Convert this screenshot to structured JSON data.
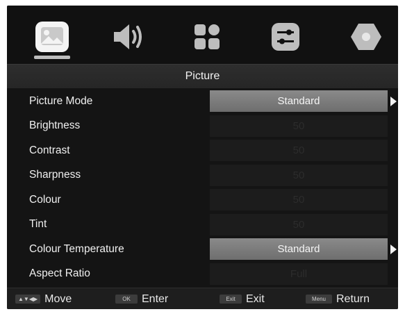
{
  "menu_tabs": [
    {
      "name": "picture-icon",
      "selected": true
    },
    {
      "name": "sound-icon",
      "selected": false
    },
    {
      "name": "apps-icon",
      "selected": false
    },
    {
      "name": "settings-sliders-icon",
      "selected": false
    },
    {
      "name": "lock-icon",
      "selected": false
    }
  ],
  "title": "Picture",
  "rows": [
    {
      "label": "Picture Mode",
      "value": "Standard",
      "selected": true
    },
    {
      "label": "Brightness",
      "value": "50",
      "selected": false
    },
    {
      "label": "Contrast",
      "value": "50",
      "selected": false
    },
    {
      "label": "Sharpness",
      "value": "50",
      "selected": false
    },
    {
      "label": "Colour",
      "value": "50",
      "selected": false
    },
    {
      "label": "Tint",
      "value": "50",
      "selected": false
    },
    {
      "label": "Colour Temperature",
      "value": "Standard",
      "selected": true
    },
    {
      "label": "Aspect Ratio",
      "value": "Full",
      "selected": false
    }
  ],
  "help": [
    {
      "key": "▲▼◀▶",
      "label": "Move"
    },
    {
      "key": "OK",
      "label": "Enter"
    },
    {
      "key": "Exit",
      "label": "Exit"
    },
    {
      "key": "Menu",
      "label": "Return"
    }
  ],
  "colors": {
    "background": "#141414",
    "selected_value": "#7c7c7c",
    "text": "#f0f0f0"
  }
}
